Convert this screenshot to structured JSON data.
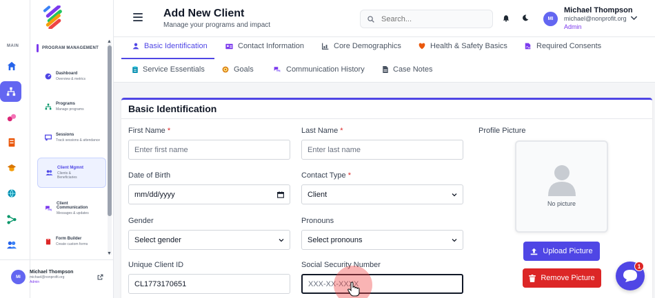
{
  "header": {
    "title": "Add New Client",
    "subtitle": "Manage your programs and impact",
    "search_placeholder": "Search...",
    "user": {
      "initials": "MI",
      "name": "Michael Thompson",
      "email": "michael@nonprofit.org",
      "role": "Admin"
    }
  },
  "rail": {
    "label": "MAIN",
    "icons": [
      "home-icon",
      "programs-icon",
      "sessions-icon",
      "documents-icon",
      "education-icon",
      "globe-icon",
      "network-icon",
      "users-icon"
    ],
    "active_index": 1,
    "colors": {
      "active_bg": "#6366f1"
    }
  },
  "panel": {
    "heading": "PROGRAM MANAGEMENT",
    "items": [
      {
        "title": "Dashboard",
        "subtitle": "Overview & metrics",
        "icon": "gauge-icon"
      },
      {
        "title": "Programs",
        "subtitle": "Manage programs",
        "icon": "sitemap-icon"
      },
      {
        "title": "Sessions",
        "subtitle": "Track sessions & attendance",
        "icon": "chalkboard-icon"
      },
      {
        "title": "Client Mgmnt",
        "subtitle": "Clients & Beneficiaries",
        "icon": "users-icon",
        "active": true
      },
      {
        "title": "Client Communication",
        "subtitle": "Messages & updates",
        "icon": "comments-icon"
      },
      {
        "title": "Form Builder",
        "subtitle": "Create custom forms",
        "icon": "clipboard-icon"
      }
    ],
    "user": {
      "initials": "MI",
      "name": "Michael Thompson",
      "email": "michael@nonprofit.org",
      "role": "Admin"
    }
  },
  "tabs": {
    "row1": [
      {
        "label": "Basic Identification",
        "icon": "user-icon",
        "active": true
      },
      {
        "label": "Contact Information",
        "icon": "id-card-icon"
      },
      {
        "label": "Core Demographics",
        "icon": "chart-icon"
      },
      {
        "label": "Health & Safety Basics",
        "icon": "heart-shield-icon"
      },
      {
        "label": "Required Consents",
        "icon": "signature-icon"
      }
    ],
    "row2": [
      {
        "label": "Service Essentials",
        "icon": "clipboard-list-icon"
      },
      {
        "label": "Goals",
        "icon": "target-icon"
      },
      {
        "label": "Communication History",
        "icon": "comments-icon"
      },
      {
        "label": "Case Notes",
        "icon": "file-icon"
      }
    ]
  },
  "form": {
    "section_title": "Basic Identification",
    "first_name": {
      "label": "First Name",
      "required": "*",
      "placeholder": "Enter first name"
    },
    "last_name": {
      "label": "Last Name",
      "required": "*",
      "placeholder": "Enter last name"
    },
    "dob": {
      "label": "Date of Birth",
      "placeholder": "mm/dd/yyyy"
    },
    "contact_type": {
      "label": "Contact Type",
      "required": "*",
      "value": "Client"
    },
    "gender": {
      "label": "Gender",
      "value": "Select gender"
    },
    "pronouns": {
      "label": "Pronouns",
      "value": "Select pronouns"
    },
    "client_id": {
      "label": "Unique Client ID",
      "value": "CL1773170651"
    },
    "ssn": {
      "label": "Social Security Number",
      "placeholder": "XXX-XX-XXXX"
    },
    "profile": {
      "label": "Profile Picture",
      "empty_caption": "No picture",
      "upload_label": "Upload Picture",
      "remove_label": "Remove Picture"
    }
  },
  "chat": {
    "badge_count": "1"
  },
  "colors": {
    "primary": "#4f46e5",
    "danger": "#dc2626",
    "accent": "#7c3aed"
  }
}
